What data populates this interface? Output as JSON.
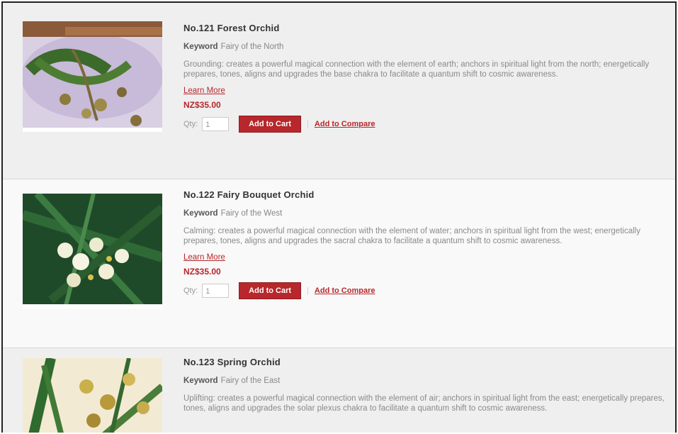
{
  "products": [
    {
      "name": "No.121 Forest Orchid",
      "keyword_label": "Keyword",
      "keyword": "Fairy of the North",
      "description": "Grounding: creates a powerful magical connection with the element of earth; anchors in spiritual light from the north; energetically prepares, tones, aligns and upgrades the base chakra to facilitate a quantum shift to cosmic awareness.",
      "learn_more": "Learn More",
      "price": "NZ$35.00",
      "qty_label": "Qty:",
      "qty_value": "1",
      "add_to_cart": "Add to Cart",
      "add_to_compare": "Add to Compare",
      "image_icon": "forest-orchid-painting"
    },
    {
      "name": "No.122 Fairy Bouquet Orchid",
      "keyword_label": "Keyword",
      "keyword": "Fairy of the West",
      "description": "Calming: creates a powerful magical connection with the element of water; anchors in spiritual light from the west; energetically prepares, tones, aligns and upgrades the sacral chakra to facilitate a quantum shift to cosmic awareness.",
      "learn_more": "Learn More",
      "price": "NZ$35.00",
      "qty_label": "Qty:",
      "qty_value": "1",
      "add_to_cart": "Add to Cart",
      "add_to_compare": "Add to Compare",
      "image_icon": "fairy-bouquet-orchid-painting"
    },
    {
      "name": "No.123 Spring Orchid",
      "keyword_label": "Keyword",
      "keyword": "Fairy of the East",
      "description": "Uplifting: creates a powerful magical connection with the element of air; anchors in spiritual light from the east; energetically prepares, tones, aligns and upgrades the solar plexus chakra to facilitate a quantum shift to cosmic awareness.",
      "image_icon": "spring-orchid-painting"
    }
  ],
  "colors": {
    "accent": "#b7272b",
    "row_bg": "#efefef",
    "row_bg_alt": "#f9f9f9"
  },
  "separator": "|"
}
